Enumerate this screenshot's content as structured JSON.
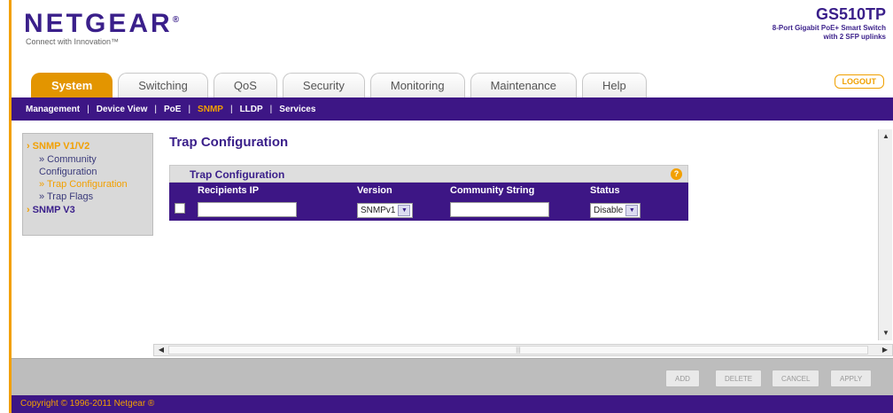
{
  "header": {
    "logo": "NETGEAR",
    "logo_mark": "®",
    "tagline": "Connect with Innovation™",
    "model": "GS510TP",
    "model_desc_1": "8-Port Gigabit PoE+ Smart Switch",
    "model_desc_2": "with 2 SFP uplinks",
    "logout": "LOGOUT"
  },
  "tabs": [
    {
      "label": "System",
      "active": true
    },
    {
      "label": "Switching",
      "active": false
    },
    {
      "label": "QoS",
      "active": false
    },
    {
      "label": "Security",
      "active": false
    },
    {
      "label": "Monitoring",
      "active": false
    },
    {
      "label": "Maintenance",
      "active": false
    },
    {
      "label": "Help",
      "active": false
    }
  ],
  "subnav": [
    {
      "label": "Management",
      "active": false
    },
    {
      "label": "Device View",
      "active": false
    },
    {
      "label": "PoE",
      "active": false
    },
    {
      "label": "SNMP",
      "active": true
    },
    {
      "label": "LLDP",
      "active": false
    },
    {
      "label": "Services",
      "active": false
    }
  ],
  "sidebar": {
    "group1": "SNMP V1/V2",
    "items": [
      "» Community Configuration",
      "» Trap Configuration",
      "» Trap Flags"
    ],
    "group2": "SNMP V3"
  },
  "content": {
    "page_title": "Trap Configuration",
    "panel_title": "Trap Configuration",
    "help_icon_glyph": "?",
    "columns": [
      "Recipients IP",
      "Version",
      "Community String",
      "Status"
    ],
    "row": {
      "recipients_ip": "",
      "version": "SNMPv1",
      "community_string": "",
      "status": "Disable"
    }
  },
  "buttons": {
    "add": "ADD",
    "delete": "DELETE",
    "cancel": "CANCEL",
    "apply": "APPLY"
  },
  "footer": "Copyright © 1996-2011 Netgear ®",
  "colors": {
    "brand_purple": "#3d1685",
    "accent_orange": "#f2a000"
  }
}
